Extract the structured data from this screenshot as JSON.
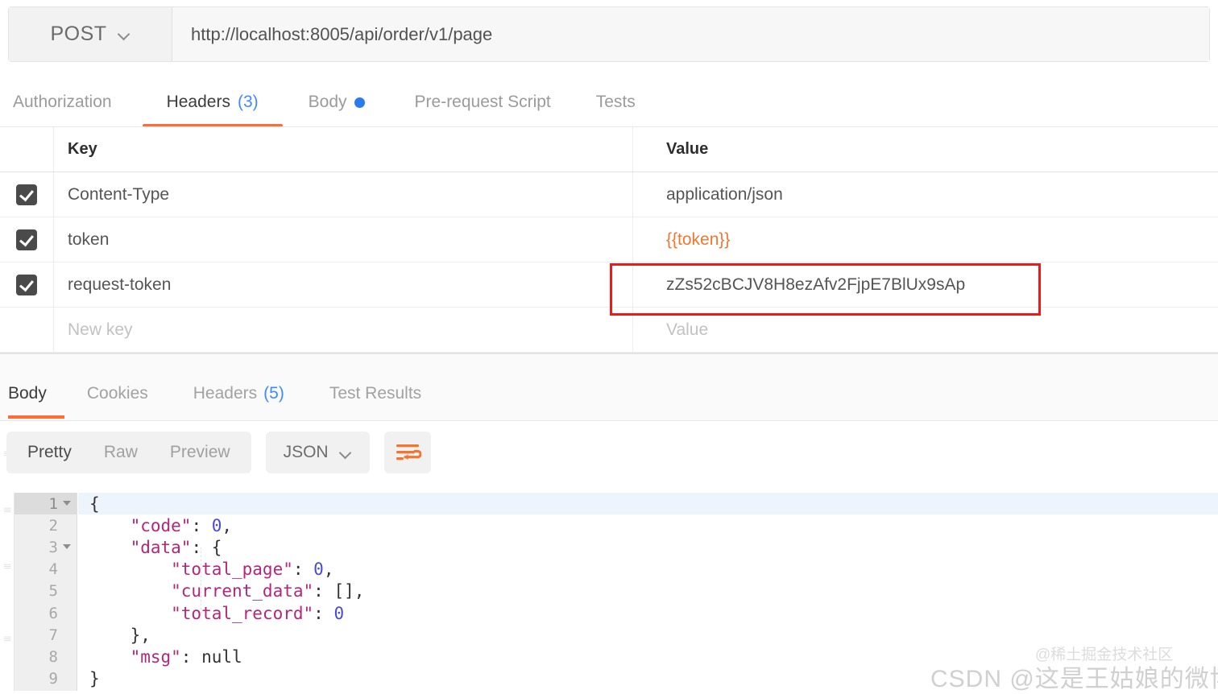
{
  "request_bar": {
    "method": "POST",
    "method_caret": "chevron-down-icon",
    "url": "http://localhost:8005/api/order/v1/page"
  },
  "request_tabs": [
    {
      "label": "Authorization",
      "count": "",
      "active": false,
      "dot": false
    },
    {
      "label": "Headers",
      "count": "(3)",
      "active": true,
      "dot": false
    },
    {
      "label": "Body",
      "count": "",
      "active": false,
      "dot": true
    },
    {
      "label": "Pre-request Script",
      "count": "",
      "active": false,
      "dot": false
    },
    {
      "label": "Tests",
      "count": "",
      "active": false,
      "dot": false
    }
  ],
  "headers_table": {
    "columns": {
      "key": "Key",
      "value": "Value"
    },
    "rows": [
      {
        "checked": true,
        "key": "Content-Type",
        "value": "application/json",
        "value_style": "plain",
        "highlighted": false
      },
      {
        "checked": true,
        "key": "token",
        "value": "{{token}}",
        "value_style": "variable",
        "highlighted": false
      },
      {
        "checked": true,
        "key": "request-token",
        "value": "zZs52cBCJV8H8ezAfv2FjpE7BlUx9sAp",
        "value_style": "plain",
        "highlighted": true
      },
      {
        "checked": false,
        "key": "New key",
        "value": "Value",
        "value_style": "placeholder",
        "highlighted": false
      }
    ]
  },
  "response_tabs": [
    {
      "label": "Body",
      "count": "",
      "active": true
    },
    {
      "label": "Cookies",
      "count": "",
      "active": false
    },
    {
      "label": "Headers",
      "count": "(5)",
      "active": false
    },
    {
      "label": "Test Results",
      "count": "",
      "active": false
    }
  ],
  "view_controls": {
    "segments": [
      {
        "label": "Pretty",
        "selected": true
      },
      {
        "label": "Raw",
        "selected": false
      },
      {
        "label": "Preview",
        "selected": false
      }
    ],
    "format": "JSON",
    "format_caret": "chevron-down-icon",
    "wrap_button": "wrap-lines-icon"
  },
  "code_viewer": {
    "lines": [
      {
        "n": "1",
        "fold": true,
        "highlighted": true,
        "segments": [
          {
            "t": "{",
            "c": "jpun"
          }
        ]
      },
      {
        "n": "2",
        "fold": false,
        "highlighted": false,
        "segments": [
          {
            "t": "    \"code\"",
            "c": "jkey"
          },
          {
            "t": ": ",
            "c": "jpun"
          },
          {
            "t": "0",
            "c": "jnum"
          },
          {
            "t": ",",
            "c": "jpun"
          }
        ]
      },
      {
        "n": "3",
        "fold": true,
        "highlighted": false,
        "segments": [
          {
            "t": "    \"data\"",
            "c": "jkey"
          },
          {
            "t": ": {",
            "c": "jpun"
          }
        ]
      },
      {
        "n": "4",
        "fold": false,
        "highlighted": false,
        "segments": [
          {
            "t": "        \"total_page\"",
            "c": "jkey"
          },
          {
            "t": ": ",
            "c": "jpun"
          },
          {
            "t": "0",
            "c": "jnum"
          },
          {
            "t": ",",
            "c": "jpun"
          }
        ]
      },
      {
        "n": "5",
        "fold": false,
        "highlighted": false,
        "segments": [
          {
            "t": "        \"current_data\"",
            "c": "jkey"
          },
          {
            "t": ": [],",
            "c": "jpun"
          }
        ]
      },
      {
        "n": "6",
        "fold": false,
        "highlighted": false,
        "segments": [
          {
            "t": "        \"total_record\"",
            "c": "jkey"
          },
          {
            "t": ": ",
            "c": "jpun"
          },
          {
            "t": "0",
            "c": "jnum"
          }
        ]
      },
      {
        "n": "7",
        "fold": false,
        "highlighted": false,
        "segments": [
          {
            "t": "    },",
            "c": "jpun"
          }
        ]
      },
      {
        "n": "8",
        "fold": false,
        "highlighted": false,
        "segments": [
          {
            "t": "    \"msg\"",
            "c": "jkey"
          },
          {
            "t": ": null",
            "c": "jpun"
          }
        ]
      },
      {
        "n": "9",
        "fold": false,
        "highlighted": false,
        "segments": [
          {
            "t": "}",
            "c": "jpun"
          }
        ]
      }
    ]
  },
  "watermarks": {
    "primary": "CSDN @这是王姑娘的微博",
    "secondary": "@稀土掘金技术社区"
  },
  "colors": {
    "accent_orange": "#ff6c37",
    "link_blue": "#3d8bff",
    "dot_blue": "#2a7ced",
    "variable_orange": "#f2762e",
    "annotation_red": "#f51717",
    "json_key": "#b3267a",
    "json_number": "#4a4ad6"
  }
}
